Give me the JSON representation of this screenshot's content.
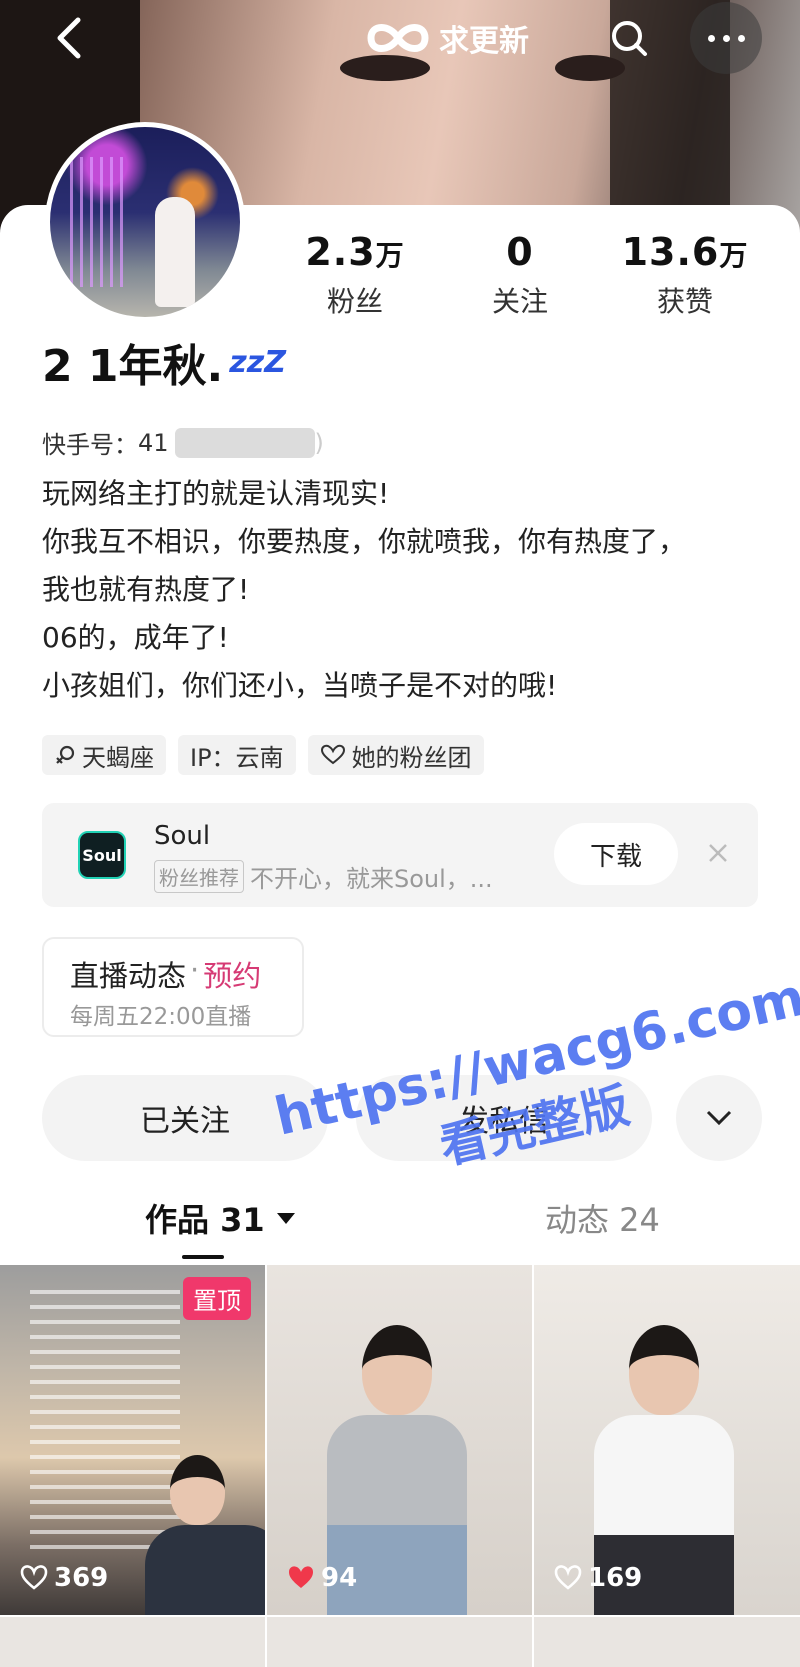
{
  "header": {
    "update_label": "求更新"
  },
  "profile": {
    "name": "2 1年秋.",
    "name_emoji": "zzZ",
    "kuaishou_label": "快手号：",
    "kuaishou_id_visible": "41",
    "kuaishou_id_tail": ")",
    "stats": [
      {
        "num": "2.3",
        "unit": "万",
        "label": "粉丝"
      },
      {
        "num": "0",
        "unit": "",
        "label": "关注"
      },
      {
        "num": "13.6",
        "unit": "万",
        "label": "获赞"
      }
    ],
    "bio": [
      "玩网络主打的就是认清现实!",
      "你我互不相识，你要热度，你就喷我，你有热度了，",
      "我也就有热度了!",
      "06的，成年了!",
      "小孩姐们，你们还小，当喷子是不对的哦!"
    ],
    "tags": [
      "天蝎座",
      "IP：云南",
      "她的粉丝团"
    ]
  },
  "ad": {
    "app_name": "Soul",
    "logo_text": "Soul",
    "badge": "粉丝推荐",
    "slogan": "不开心，就来Soul，...",
    "download_label": "下载"
  },
  "live": {
    "title": "直播动态",
    "sep": "·",
    "reserve": "预约",
    "schedule": "每周五22:00直播"
  },
  "actions": {
    "follow_label": "已关注",
    "message_label": "发私信"
  },
  "tabs": {
    "works": "作品 31",
    "dynamics": "动态 24"
  },
  "grid": {
    "pinned_label": "置顶",
    "items": [
      {
        "likes": "369"
      },
      {
        "likes": "94"
      },
      {
        "likes": "169"
      }
    ]
  },
  "watermark": {
    "url": "https://wacg6.com",
    "text": "看完整版"
  },
  "colors": {
    "accent_pink": "#f0386b",
    "reserve_pink": "#d63a74",
    "watermark_blue": "#4f74f0"
  }
}
